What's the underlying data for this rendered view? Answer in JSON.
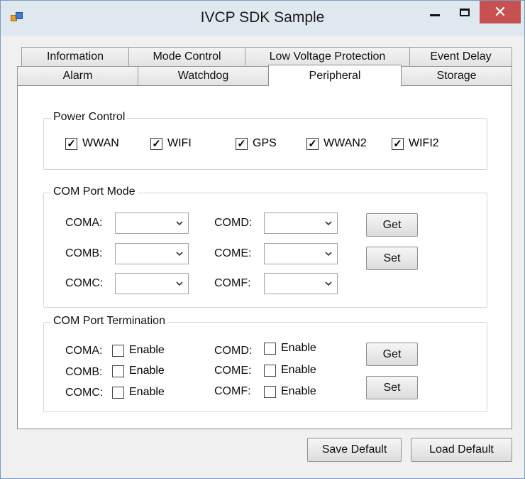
{
  "window": {
    "title": "IVCP SDK Sample",
    "icons": {
      "app": "app-icon",
      "minimize": "minimize-icon",
      "maximize": "maximize-icon",
      "close": "close-icon"
    }
  },
  "tabs": {
    "row1": [
      "Information",
      "Mode Control",
      "Low Voltage Protection",
      "Event Delay"
    ],
    "row2": [
      "Alarm",
      "Watchdog",
      "Peripheral",
      "Storage"
    ],
    "active": "Peripheral"
  },
  "power_control": {
    "title": "Power Control",
    "items": [
      {
        "label": "WWAN",
        "checked": true
      },
      {
        "label": "WIFI",
        "checked": true
      },
      {
        "label": "GPS",
        "checked": true
      },
      {
        "label": "WWAN2",
        "checked": true
      },
      {
        "label": "WIFI2",
        "checked": true
      }
    ]
  },
  "com_port_mode": {
    "title": "COM Port Mode",
    "ports_left": [
      "COMA:",
      "COMB:",
      "COMC:"
    ],
    "ports_right": [
      "COMD:",
      "COME:",
      "COMF:"
    ],
    "values": [
      "",
      "",
      "",
      "",
      "",
      ""
    ],
    "get_label": "Get",
    "set_label": "Set"
  },
  "com_port_termination": {
    "title": "COM Port Termination",
    "ports_left": [
      "COMA:",
      "COMB:",
      "COMC:"
    ],
    "ports_right": [
      "COMD:",
      "COME:",
      "COMF:"
    ],
    "enable_label": "Enable",
    "get_label": "Get",
    "set_label": "Set"
  },
  "footer": {
    "save_default": "Save Default",
    "load_default": "Load Default"
  }
}
